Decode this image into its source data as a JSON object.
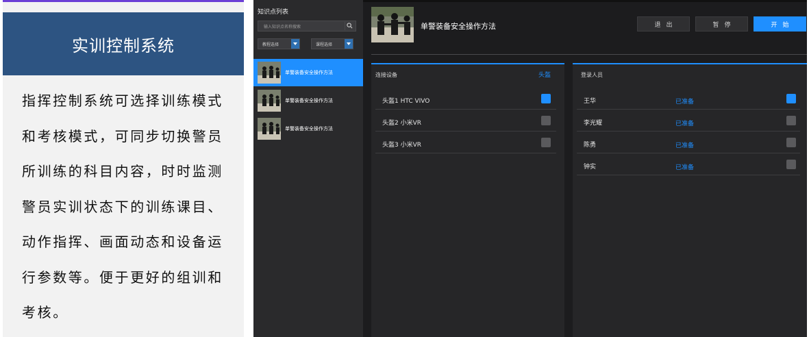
{
  "description": {
    "title": "实训控制系统",
    "lines": [
      "指挥控制系统可选择训练模式",
      "和考核模式，可同步切换警员",
      "所训练的科目内容，时时监测",
      "警员实训状态下的训练课目、",
      "动作指挥、画面动态和设备运",
      "行参数等。便于更好的组训和",
      "考核。"
    ]
  },
  "app": {
    "sidebar": {
      "title": "知识点列表",
      "search_placeholder": "输入知识点名称搜索",
      "select_1": "教程选择",
      "select_2": "课程选择",
      "items": [
        {
          "label": "单警装备安全操作方法"
        },
        {
          "label": "单警装备安全操作方法"
        },
        {
          "label": "单警装备安全操作方法"
        }
      ]
    },
    "header": {
      "lesson_title": "单警装备安全操作方法",
      "exit_label": "退出",
      "pause_label": "暂停",
      "start_label": "开始"
    },
    "devices": {
      "heading": "连接设备",
      "tag": "头盔",
      "rows": [
        {
          "name": "头盔1 HTC VIVO",
          "checked": true
        },
        {
          "name": "头盔2 小米VR",
          "checked": false
        },
        {
          "name": "头盔3 小米VR",
          "checked": false
        }
      ]
    },
    "users": {
      "heading": "登录人员",
      "rows": [
        {
          "name": "王华",
          "status": "已准备",
          "checked": true
        },
        {
          "name": "李光耀",
          "status": "已准备",
          "checked": false
        },
        {
          "name": "陈勇",
          "status": "已准备",
          "checked": false
        },
        {
          "name": "钟实",
          "status": "已准备",
          "checked": false
        }
      ]
    },
    "colors": {
      "accent": "#1f8fff",
      "header_blue": "#2d5482"
    }
  }
}
